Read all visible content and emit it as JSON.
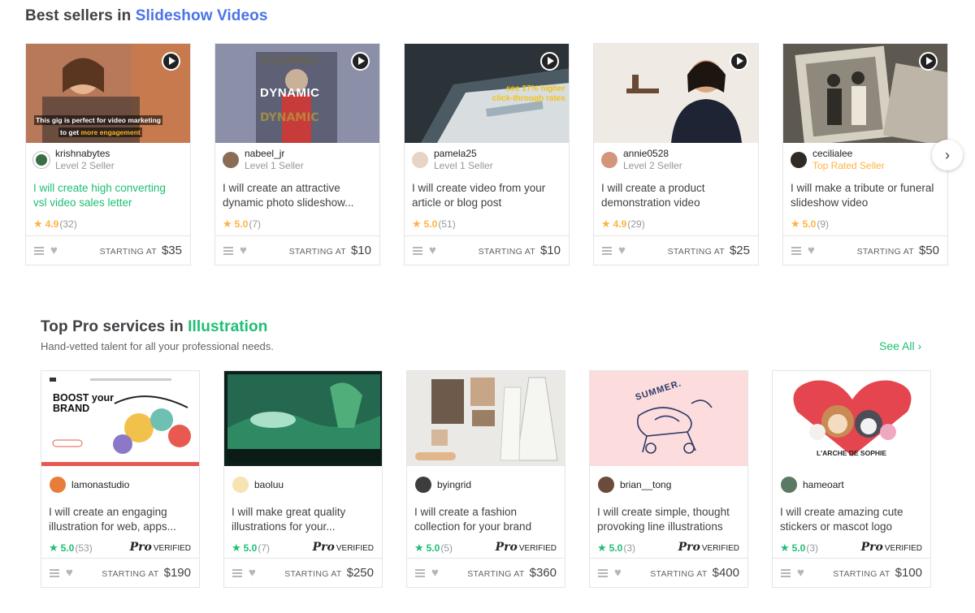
{
  "section1": {
    "title_prefix": "Best sellers in ",
    "title_accent": "Slideshow Videos"
  },
  "section2": {
    "title_prefix": "Top Pro services in ",
    "title_accent": "Illustration",
    "subtitle": "Hand-vetted talent for all your professional needs.",
    "see_all": "See All"
  },
  "labels": {
    "starting_at": "STARTING AT",
    "pro": "Pro",
    "verified": "VERIFIED"
  },
  "icons": {
    "play": "play-icon",
    "menu": "menu-icon",
    "heart": "heart-icon",
    "star": "star-icon",
    "next": "chevron-right-icon"
  },
  "colors": {
    "accent_blue": "#4a73e8",
    "accent_green": "#1dbf73",
    "star_yellow": "#ffb33e"
  },
  "slideshow_gigs": [
    {
      "thumb_caption_1": "This gig is perfect for video marketing",
      "thumb_caption_2": "to get ",
      "thumb_caption_3": "more engagement",
      "seller": "krishnabytes",
      "level": "Level 2 Seller",
      "title": "I will create high converting vsl video sales letter",
      "score": "4.9",
      "count": "(32)",
      "price": "$35"
    },
    {
      "thumb_caption_1": "DYNAMIC",
      "seller": "nabeel_jr",
      "level": "Level 1 Seller",
      "title": "I will create an attractive dynamic photo slideshow...",
      "score": "5.0",
      "count": "(7)",
      "price": "$10"
    },
    {
      "thumb_caption_1": "see 27% higher",
      "thumb_caption_2": "click-through rates",
      "seller": "pamela25",
      "level": "Level 1 Seller",
      "title": "I will create video from your article or blog post",
      "score": "5.0",
      "count": "(51)",
      "price": "$10"
    },
    {
      "seller": "annie0528",
      "level": "Level 2 Seller",
      "title": "I will create a product demonstration video",
      "score": "4.9",
      "count": "(29)",
      "price": "$25"
    },
    {
      "seller": "cecilialee",
      "level": "Top Rated Seller",
      "title": "I will make a tribute or funeral slideshow video",
      "score": "5.0",
      "count": "(9)",
      "price": "$50"
    }
  ],
  "pro_gigs": [
    {
      "thumb_caption_1": "BOOST your",
      "thumb_caption_2": "BRAND",
      "seller": "lamonastudio",
      "title": "I will create an engaging illustration for web, apps...",
      "score": "5.0",
      "count": "(53)",
      "price": "$190"
    },
    {
      "seller": "baoluu",
      "title": "I will make great quality illustrations for your...",
      "score": "5.0",
      "count": "(7)",
      "price": "$250"
    },
    {
      "seller": "byingrid",
      "title": "I will create a fashion collection for your brand",
      "score": "5.0",
      "count": "(5)",
      "price": "$360"
    },
    {
      "thumb_caption_1": "SUMMER.",
      "seller": "brian__tong",
      "title": "I will create simple, thought provoking line illustrations",
      "score": "5.0",
      "count": "(3)",
      "price": "$400"
    },
    {
      "thumb_caption_1": "L'ARCHE DE SOPHIE",
      "seller": "hameoart",
      "title": "I will create amazing cute stickers or mascot logo",
      "score": "5.0",
      "count": "(3)",
      "price": "$100"
    }
  ]
}
